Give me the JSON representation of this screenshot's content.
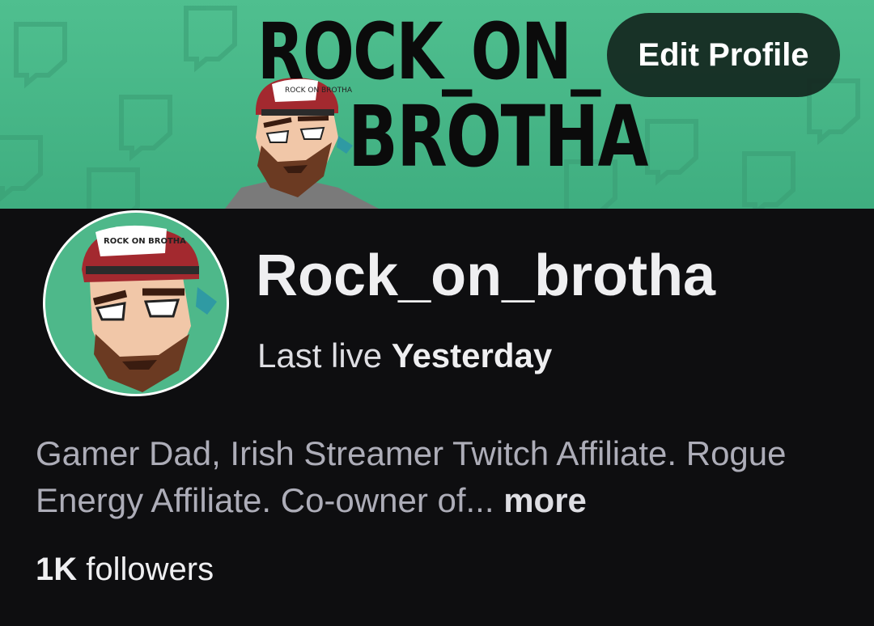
{
  "banner": {
    "title_line1": "ROCK_ON_",
    "title_line2": "BROTHA",
    "cap_text": "ROCK ON BROTHA",
    "background_color": "#4fbf8f"
  },
  "header": {
    "edit_button_label": "Edit Profile"
  },
  "avatar": {
    "cap_text": "ROCK ON BROTHA",
    "background_color": "#4eb88a"
  },
  "profile": {
    "channel_name": "Rock_on_brotha",
    "last_live_label": "Last live",
    "last_live_value": "Yesterday",
    "bio_text": "Gamer Dad, Irish Streamer Twitch Affiliate. Rogue Energy Affiliate. Co-owner of...",
    "bio_more_label": "more",
    "followers_count": "1K",
    "followers_label": "followers"
  }
}
